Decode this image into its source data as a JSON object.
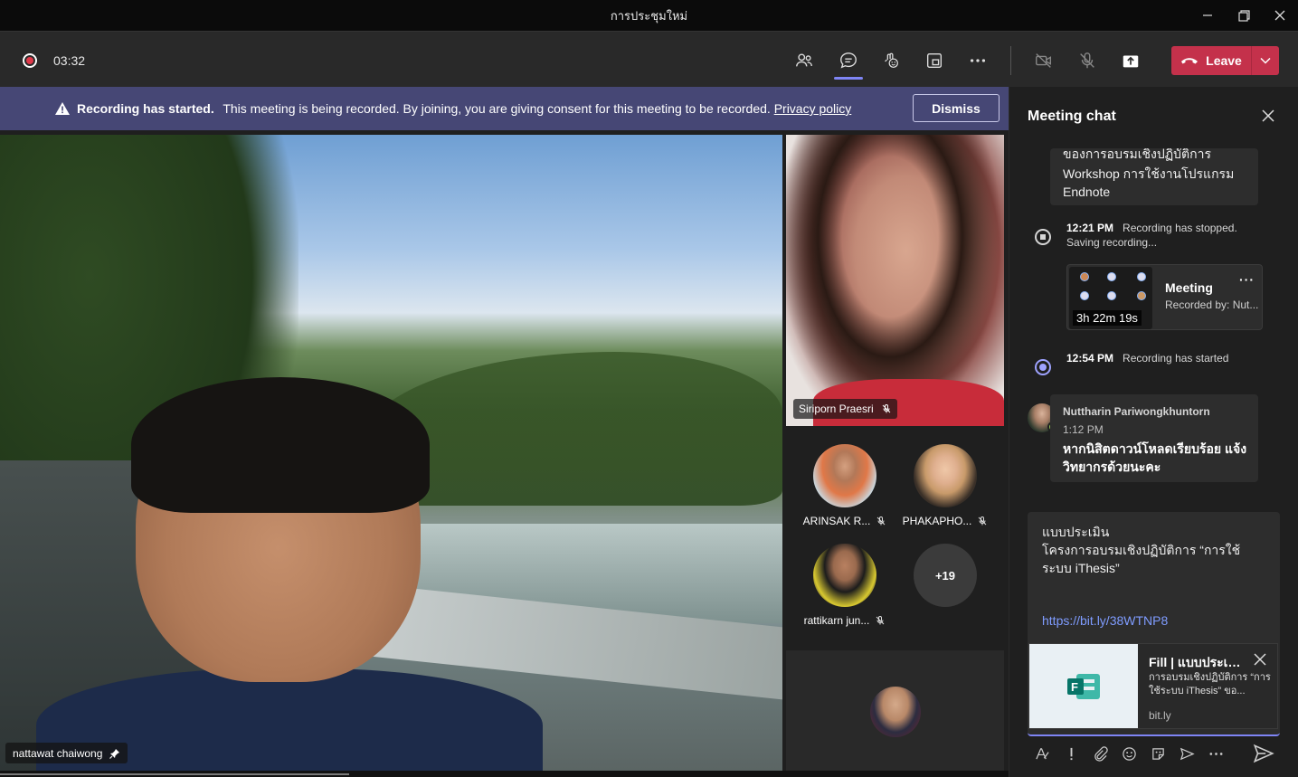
{
  "window": {
    "title": "การประชุมใหม่",
    "controls": [
      "minimize-icon",
      "restore-icon",
      "close-icon"
    ]
  },
  "toolbar": {
    "timer": "03:32",
    "buttons": [
      "people-icon",
      "chat-icon",
      "reactions-icon",
      "rooms-icon",
      "more-icon",
      "camera-off-icon",
      "mic-off-icon",
      "share-icon"
    ],
    "leave_label": "Leave"
  },
  "banner": {
    "title": "Recording has started.",
    "message": "This meeting is being recorded. By joining, you are giving consent for this meeting to be recorded.",
    "link": "Privacy policy",
    "dismiss_label": "Dismiss"
  },
  "stage": {
    "main_participant": "nattawat chaiwong",
    "side_participant": "Siriporn Praesri",
    "grid": [
      {
        "name": "ARINSAK R..."
      },
      {
        "name": "PHAKAPHO..."
      },
      {
        "name": "rattikarn jun..."
      }
    ],
    "more_count": "+19"
  },
  "chat": {
    "title": "Meeting chat",
    "first_bubble_clip": "ของการอบรมเชิงปฏิบัติการ",
    "first_bubble_lines": [
      "Workshop  การใช้งานโปรแกรม",
      "Endnote"
    ],
    "events": [
      {
        "time": "12:21 PM",
        "text": "Recording has stopped. Saving recording..."
      },
      {
        "time": "12:54 PM",
        "text": "Recording has started"
      }
    ],
    "recording_card": {
      "title": "Meeting",
      "subtitle": "Recorded by: Nut...",
      "duration": "3h 22m 19s"
    },
    "message": {
      "author": "Nuttharin Pariwongkhuntorn",
      "time": "1:12 PM",
      "text": "หากนิสิตดาวน์โหลดเรียบร้อย แจ้งวิทยากรด้วยนะคะ"
    },
    "compose": {
      "lines": [
        "แบบประเมิน",
        "โครงการอบรมเชิงปฏิบัติการ “การใช้ระบบ iThesis”"
      ],
      "link": "https://bit.ly/38WTNP8",
      "preview": {
        "title": "Fill | แบบประเมิน...",
        "description": "การอบรมเชิงปฏิบัติการ “การใช้ระบบ iThesis” ขอ...",
        "domain": "bit.ly"
      },
      "tools": [
        "format-icon",
        "important-icon",
        "attach-icon",
        "emoji-icon",
        "sticker-icon",
        "schedule-icon",
        "more-options-icon"
      ]
    }
  }
}
